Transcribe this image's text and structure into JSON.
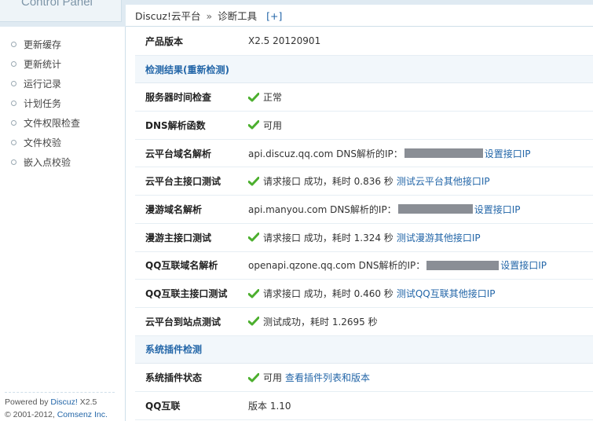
{
  "sidebar": {
    "logo": "Control Panel",
    "items": [
      {
        "label": "更新缓存"
      },
      {
        "label": "更新统计"
      },
      {
        "label": "运行记录"
      },
      {
        "label": "计划任务"
      },
      {
        "label": "文件权限检查"
      },
      {
        "label": "文件校验"
      },
      {
        "label": "嵌入点校验"
      }
    ],
    "powered_prefix": "Powered by ",
    "powered_brand": "Discuz!",
    "powered_version": " X2.5",
    "copyright_prefix": "© 2001-2012, ",
    "copyright_company": "Comsenz Inc."
  },
  "header": {
    "crumb1": "Discuz!云平台",
    "sep": "»",
    "crumb2": "诊断工具",
    "plus": "[+]"
  },
  "rows": {
    "version": {
      "label": "产品版本",
      "value": "X2.5 20120901"
    },
    "section1": {
      "title": "检测结果(重新检测)"
    },
    "time_check": {
      "label": "服务器时间检查",
      "value": "正常"
    },
    "dns_func": {
      "label": "DNS解析函数",
      "value": "可用"
    },
    "cloud_dns": {
      "label": "云平台域名解析",
      "domain": "api.discuz.qq.com DNS解析的IP：",
      "link": "设置接口IP"
    },
    "cloud_main": {
      "label": "云平台主接口测试",
      "value": "请求接口 成功，耗时  0.836 秒",
      "link": "测试云平台其他接口IP"
    },
    "manyou_dns": {
      "label": "漫游域名解析",
      "domain": "api.manyou.com DNS解析的IP：",
      "link": "设置接口IP"
    },
    "manyou_main": {
      "label": "漫游主接口测试",
      "value": "请求接口 成功，耗时  1.324 秒",
      "link": "测试漫游其他接口IP"
    },
    "qq_dns": {
      "label": "QQ互联域名解析",
      "domain": "openapi.qzone.qq.com DNS解析的IP：",
      "link": "设置接口IP"
    },
    "qq_main": {
      "label": "QQ互联主接口测试",
      "value": "请求接口 成功，耗时  0.460 秒",
      "link": "测试QQ互联其他接口IP"
    },
    "site_test": {
      "label": "云平台到站点测试",
      "value": "测试成功，耗时  1.2695 秒"
    },
    "section2": {
      "title": "系统插件检测"
    },
    "plugin_status": {
      "label": "系统插件状态",
      "value": "可用",
      "link": "查看插件列表和版本"
    },
    "qq_connect": {
      "label": "QQ互联",
      "value": "版本  1.10"
    }
  },
  "colors": {
    "accent": "#2366a8",
    "check": "#4caf2e",
    "mask": "#8a8e95"
  }
}
